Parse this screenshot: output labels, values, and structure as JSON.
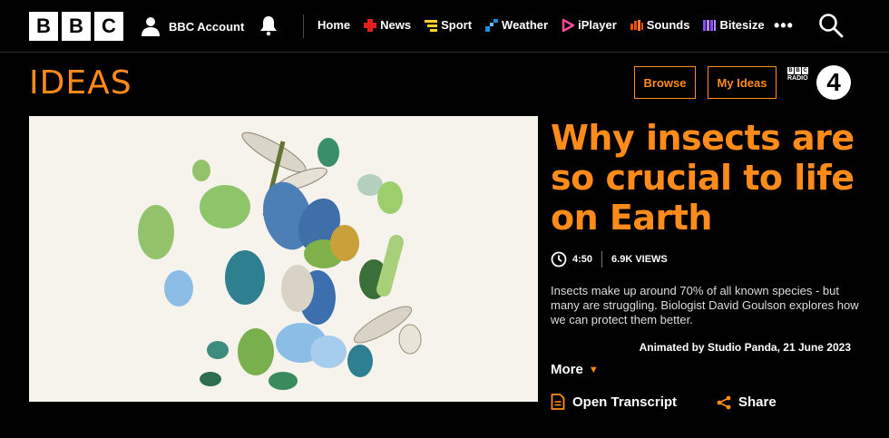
{
  "header": {
    "logo_letters": [
      "B",
      "B",
      "C"
    ],
    "account_label": "BBC Account",
    "nav": [
      {
        "label": "Home",
        "icon": "none",
        "color": ""
      },
      {
        "label": "News",
        "icon": "news-icon",
        "color": "#e1201c"
      },
      {
        "label": "Sport",
        "icon": "sport-icon",
        "color": "#ffd230"
      },
      {
        "label": "Weather",
        "icon": "weather-icon",
        "color": "#1d90e0"
      },
      {
        "label": "iPlayer",
        "icon": "iplayer-icon",
        "color": "#f54997"
      },
      {
        "label": "Sounds",
        "icon": "sounds-icon",
        "color": "#ff4c00"
      },
      {
        "label": "Bitesize",
        "icon": "bitesize-icon",
        "color": "#8a4dff"
      }
    ],
    "more_label": "•••"
  },
  "section": {
    "logo": "IDEAS",
    "browse_label": "Browse",
    "my_ideas_label": "My Ideas",
    "radio_mini": [
      "RADIO"
    ],
    "radio_number": "4",
    "accent": "#ff8c1a"
  },
  "article": {
    "title": "Why insects are so crucial to life on Earth",
    "duration": "4:50",
    "views": "6.9K VIEWS",
    "description": "Insects make up around 70% of all known species - but many are struggling. Biologist David Goulson explores how we can protect them better.",
    "credit": "Animated by Studio Panda, 21 June 2023",
    "more_label": "More",
    "transcript_label": "Open Transcript",
    "share_label": "Share"
  }
}
